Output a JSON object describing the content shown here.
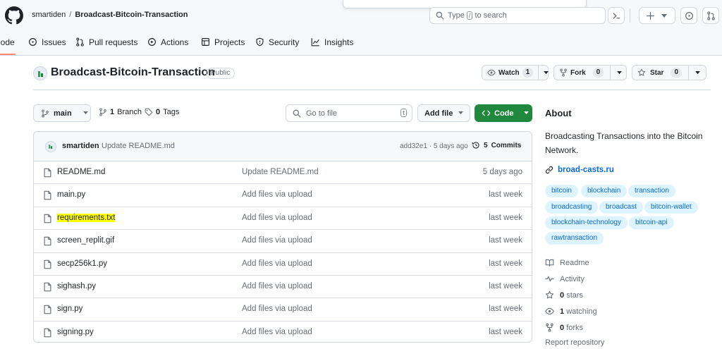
{
  "colors": {
    "accent_green": "#1f883d",
    "link_blue": "#0969da",
    "topic_bg": "#ddf4ff",
    "active_tab_underline": "#fd8c73",
    "highlight": "#ffff00",
    "header_bg": "#f6f8fa",
    "border": "#d0d7de"
  },
  "header": {
    "owner": "smartiden",
    "separator": "/",
    "repo": "Broadcast-Bitcoin-Transaction",
    "search": {
      "prefix": "Type",
      "key": "/",
      "suffix": "to search"
    },
    "icons": [
      "github-logo-icon",
      "search-icon",
      "terminal-icon",
      "plus-icon",
      "issues-icon",
      "pull-request-icon"
    ]
  },
  "tabs": [
    {
      "label": "Code",
      "icon": "code-icon",
      "active": true
    },
    {
      "label": "Issues",
      "icon": "issue-opened-icon"
    },
    {
      "label": "Pull requests",
      "icon": "git-pull-request-icon"
    },
    {
      "label": "Actions",
      "icon": "play-icon"
    },
    {
      "label": "Projects",
      "icon": "table-icon"
    },
    {
      "label": "Security",
      "icon": "shield-icon"
    },
    {
      "label": "Insights",
      "icon": "graph-icon"
    }
  ],
  "repo": {
    "title": "Broadcast-Bitcoin-Transaction",
    "visibility": "Public",
    "watch": {
      "label": "Watch",
      "count": "1"
    },
    "fork": {
      "label": "Fork",
      "count": "0"
    },
    "star": {
      "label": "Star",
      "count": "0"
    }
  },
  "toolbar": {
    "branch": "main",
    "branches": {
      "count": "1",
      "label": "Branch"
    },
    "tags": {
      "count": "0",
      "label": "Tags"
    },
    "goto_placeholder": "Go to file",
    "goto_key": "t",
    "add_file": "Add file",
    "code": "Code"
  },
  "commit": {
    "user": "smartiden",
    "message": "Update README.md",
    "sha_time": "add32e1 · 5 days ago",
    "commits_count": "5",
    "commits_label": "Commits"
  },
  "files": [
    {
      "name": "README.md",
      "message": "Update README.md",
      "age": "5 days ago"
    },
    {
      "name": "main.py",
      "message": "Add files via upload",
      "age": "last week"
    },
    {
      "name": "requirements.txt",
      "message": "Add files via upload",
      "age": "last week",
      "highlighted": true
    },
    {
      "name": "screen_replit.gif",
      "message": "Add files via upload",
      "age": "last week"
    },
    {
      "name": "secp256k1.py",
      "message": "Add files via upload",
      "age": "last week"
    },
    {
      "name": "sighash.py",
      "message": "Add files via upload",
      "age": "last week"
    },
    {
      "name": "sign.py",
      "message": "Add files via upload",
      "age": "last week"
    },
    {
      "name": "signing.py",
      "message": "Add files via upload",
      "age": "last week"
    }
  ],
  "about": {
    "title": "About",
    "description": "Broadcasting Transactions into the Bitcoin Network.",
    "website": "broad-casts.ru",
    "topics": [
      "bitcoin",
      "blockchain",
      "transaction",
      "broadcasting",
      "broadcast",
      "bitcoin-wallet",
      "blockchain-technology",
      "bitcoin-api",
      "rawtransaction"
    ],
    "readme": "Readme",
    "activity": "Activity",
    "stars": {
      "count": "0",
      "label": "stars"
    },
    "watching": {
      "count": "1",
      "label": "watching"
    },
    "forks": {
      "count": "0",
      "label": "forks"
    },
    "report": "Report repository"
  }
}
